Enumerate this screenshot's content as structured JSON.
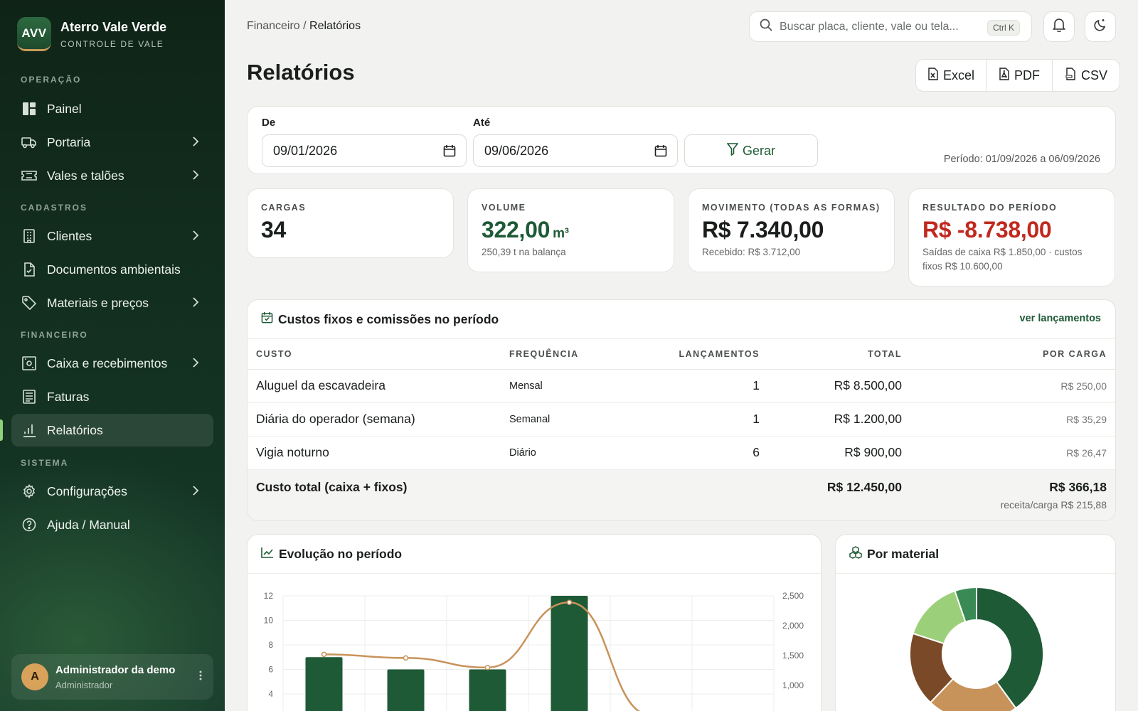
{
  "brand": {
    "logo": "AVV",
    "title": "Aterro Vale Verde",
    "subtitle": "CONTROLE DE VALE"
  },
  "sidebar": {
    "sections": [
      "OPERAÇÃO",
      "CADASTROS",
      "FINANCEIRO",
      "SISTEMA"
    ],
    "items": [
      {
        "label": "Painel",
        "icon": "dashboard-icon"
      },
      {
        "label": "Portaria",
        "icon": "truck-icon"
      },
      {
        "label": "Vales e talões",
        "icon": "ticket-icon"
      },
      {
        "label": "Clientes",
        "icon": "building-icon"
      },
      {
        "label": "Documentos ambientais",
        "icon": "document-icon"
      },
      {
        "label": "Materiais e preços",
        "icon": "tag-icon"
      },
      {
        "label": "Caixa e recebimentos",
        "icon": "cashbox-icon"
      },
      {
        "label": "Faturas",
        "icon": "invoice-icon"
      },
      {
        "label": "Relatórios",
        "icon": "bar-chart-icon"
      },
      {
        "label": "Configurações",
        "icon": "gear-icon"
      },
      {
        "label": "Ajuda / Manual",
        "icon": "help-icon"
      }
    ],
    "active": "Relatórios"
  },
  "user": {
    "initial": "A",
    "name": "Administrador da demo",
    "role": "Administrador"
  },
  "header": {
    "breadcrumb_parent": "Financeiro /",
    "breadcrumb_current": "Relatórios",
    "search_placeholder": "Buscar placa, cliente, vale ou tela...",
    "search_shortcut": "Ctrl K"
  },
  "page": {
    "title": "Relatórios"
  },
  "exports": {
    "excel": "Excel",
    "pdf": "PDF",
    "csv": "CSV"
  },
  "filter": {
    "from_label": "De",
    "from_value": "09/01/2026",
    "to_label": "Até",
    "to_value": "09/06/2026",
    "button": "Gerar",
    "period": "Período: 01/09/2026 a 06/09/2026"
  },
  "kpis": [
    {
      "label": "CARGAS",
      "value": "34",
      "unit": "",
      "sub": ""
    },
    {
      "label": "VOLUME",
      "value": "322,00",
      "unit": "m³",
      "sub": "250,39 t na balança"
    },
    {
      "label": "MOVIMENTO (TODAS AS FORMAS)",
      "value": "R$ 7.340,00",
      "unit": "",
      "sub": "Recebido: R$ 3.712,00"
    },
    {
      "label": "RESULTADO DO PERÍODO",
      "value": "R$ -8.738,00",
      "unit": "",
      "sub": "Saídas de caixa R$ 1.850,00 · custos fixos R$ 10.600,00"
    }
  ],
  "colors": {
    "green": "#1e5a36",
    "red": "#c0281e",
    "tan": "#c8935a"
  },
  "costs": {
    "title": "Custos fixos e comissões no período",
    "link": "ver lançamentos",
    "columns": [
      "CUSTO",
      "FREQUÊNCIA",
      "LANÇAMENTOS",
      "TOTAL",
      "POR CARGA"
    ],
    "rows": [
      {
        "custo": "Aluguel da escavadeira",
        "freq": "Mensal",
        "lanc": "1",
        "total": "R$ 8.500,00",
        "porcarga": "R$ 250,00"
      },
      {
        "custo": "Diária do operador (semana)",
        "freq": "Semanal",
        "lanc": "1",
        "total": "R$ 1.200,00",
        "porcarga": "R$ 35,29"
      },
      {
        "custo": "Vigia noturno",
        "freq": "Diário",
        "lanc": "6",
        "total": "R$ 900,00",
        "porcarga": "R$ 26,47"
      }
    ],
    "total_label": "Custo total (caixa + fixos)",
    "total_value": "R$ 12.450,00",
    "total_porcarga": "R$ 366,18",
    "receita_carga": "receita/carga R$ 215,88"
  },
  "evolucao": {
    "title": "Evolução no período"
  },
  "material": {
    "title": "Por material"
  },
  "chart_data": [
    {
      "type": "bar",
      "y_ticks": [
        "12",
        "10",
        "8",
        "6",
        "4"
      ],
      "y2_ticks": [
        "2,500",
        "2,000",
        "1,500",
        "1,000"
      ],
      "ylim": [
        4,
        12
      ],
      "y2lim": [
        1000,
        2500
      ],
      "series": [
        {
          "type": "bar",
          "values": [
            7,
            6,
            6,
            12
          ]
        },
        {
          "type": "line",
          "values": [
            1520,
            1460,
            1300,
            2390,
            500
          ]
        }
      ],
      "grid": true
    },
    {
      "type": "pie",
      "values": [
        38,
        21,
        17,
        14,
        5
      ],
      "colors": [
        "#1e5a36",
        "#c8935a",
        "#7a4a28",
        "#9ccf7a",
        "#3a8a55"
      ],
      "donut": true
    }
  ]
}
